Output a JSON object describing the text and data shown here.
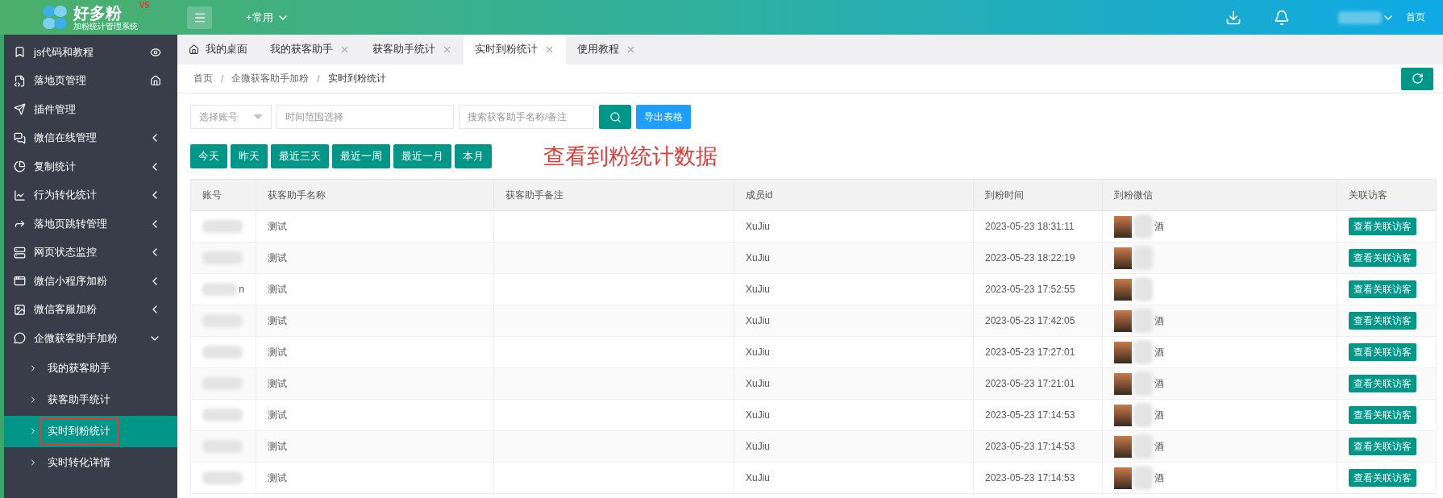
{
  "header": {
    "logo_title": "好多粉",
    "logo_version": "V5",
    "logo_subtitle": "加粉统计管理系统",
    "quick_menu": "+常用",
    "home_link": "首页"
  },
  "sidebar": {
    "items": [
      {
        "label": "js代码和教程",
        "kind": "link"
      },
      {
        "label": "落地页管理",
        "kind": "link"
      },
      {
        "label": "插件管理",
        "kind": "link"
      },
      {
        "label": "微信在线管理",
        "kind": "menu",
        "expanded": false
      },
      {
        "label": "复制统计",
        "kind": "menu",
        "expanded": false
      },
      {
        "label": "行为转化统计",
        "kind": "menu",
        "expanded": false
      },
      {
        "label": "落地页跳转管理",
        "kind": "menu",
        "expanded": false
      },
      {
        "label": "网页状态监控",
        "kind": "menu",
        "expanded": false
      },
      {
        "label": "微信小程序加粉",
        "kind": "menu",
        "expanded": false
      },
      {
        "label": "微信客服加粉",
        "kind": "menu",
        "expanded": false
      },
      {
        "label": "企微获客助手加粉",
        "kind": "menu",
        "expanded": true,
        "children": [
          {
            "label": "我的获客助手",
            "selected": false
          },
          {
            "label": "获客助手统计",
            "selected": false
          },
          {
            "label": "实时到粉统计",
            "selected": true
          },
          {
            "label": "实时转化详情",
            "selected": false
          }
        ]
      }
    ]
  },
  "tabs": [
    {
      "label": "我的桌面",
      "selected": false,
      "closable": false
    },
    {
      "label": "我的获客助手",
      "selected": false,
      "closable": true
    },
    {
      "label": "获客助手统计",
      "selected": false,
      "closable": true
    },
    {
      "label": "实时到粉统计",
      "selected": true,
      "closable": true
    },
    {
      "label": "使用教程",
      "selected": false,
      "closable": true
    }
  ],
  "breadcrumb": [
    "首页",
    "企微获客助手加粉",
    "实时到粉统计"
  ],
  "breadcrumb_separator": "/",
  "filters": {
    "account_select": {
      "placeholder": "选择账号"
    },
    "time_range": {
      "placeholder": "时间范围选择"
    },
    "search": {
      "placeholder": "搜索获客助手名称/备注"
    },
    "export_button": "导出表格"
  },
  "quick_ranges": [
    "今天",
    "昨天",
    "最近三天",
    "最近一周",
    "最近一月",
    "本月"
  ],
  "annotation": "查看到粉统计数据",
  "table": {
    "columns": [
      "账号",
      "获客助手名称",
      "获客助手备注",
      "成员id",
      "到粉时间",
      "到粉微信",
      "关联访客"
    ],
    "rows": [
      {
        "name": "测试",
        "member_id": "XuJiu",
        "time": "2023-05-23 18:31:11",
        "wechat_fragment": "酒",
        "action": "查看关联访客"
      },
      {
        "name": "测试",
        "member_id": "XuJiu",
        "time": "2023-05-23 18:22:19",
        "action": "查看关联访客"
      },
      {
        "account_fragment": "n",
        "name": "测试",
        "member_id": "XuJiu",
        "time": "2023-05-23 17:52:55",
        "action": "查看关联访客"
      },
      {
        "name": "测试",
        "member_id": "XuJiu",
        "time": "2023-05-23 17:42:05",
        "wechat_fragment": "酒",
        "action": "查看关联访客"
      },
      {
        "name": "测试",
        "member_id": "XuJiu",
        "time": "2023-05-23 17:27:01",
        "wechat_fragment": "酒",
        "action": "查看关联访客"
      },
      {
        "name": "测试",
        "member_id": "XuJiu",
        "time": "2023-05-23 17:21:01",
        "wechat_fragment": "酒",
        "action": "查看关联访客"
      },
      {
        "name": "测试",
        "member_id": "XuJiu",
        "time": "2023-05-23 17:14:53",
        "wechat_fragment": "酒",
        "action": "查看关联访客"
      },
      {
        "name": "测试",
        "member_id": "XuJiu",
        "time": "2023-05-23 17:14:53",
        "wechat_fragment": "酒",
        "action": "查看关联访客"
      },
      {
        "name": "测试",
        "member_id": "XuJiu",
        "time": "2023-05-23 17:14:53",
        "wechat_fragment": "酒",
        "action": "查看关联访客"
      }
    ]
  }
}
